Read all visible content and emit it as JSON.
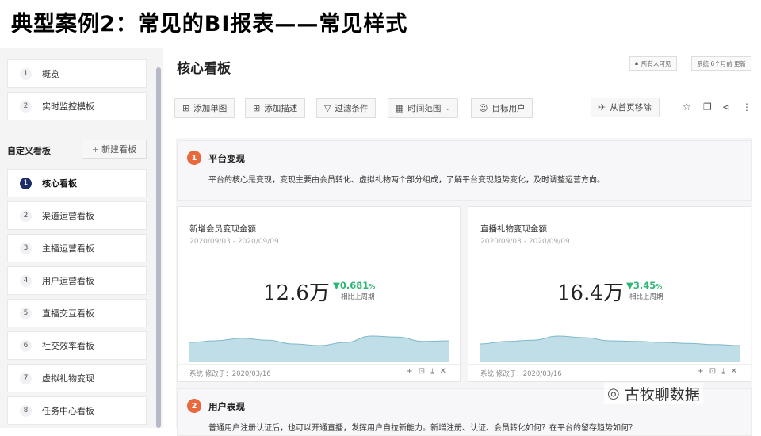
{
  "slide_title": "典型案例2：常见的BI报表——常见样式",
  "sidebar": {
    "top_items": [
      {
        "num": "1",
        "label": "概览"
      },
      {
        "num": "2",
        "label": "实时监控模板"
      }
    ],
    "section_label": "自定义看板",
    "new_board_label": "新建看板",
    "boards": [
      {
        "num": "1",
        "label": "核心看板",
        "active": true
      },
      {
        "num": "2",
        "label": "渠道运营看板"
      },
      {
        "num": "3",
        "label": "主播运营看板"
      },
      {
        "num": "4",
        "label": "用户运营看板"
      },
      {
        "num": "5",
        "label": "直播交互看板"
      },
      {
        "num": "6",
        "label": "社交效率看板"
      },
      {
        "num": "7",
        "label": "虚拟礼物变现"
      },
      {
        "num": "8",
        "label": "任务中心看板"
      }
    ]
  },
  "header": {
    "title": "核心看板",
    "visibility": "所有人可见",
    "updated": "系统 6个月前 更新"
  },
  "toolbar": {
    "add_chart": "添加单图",
    "add_desc": "添加描述",
    "filter": "过滤条件",
    "time_range": "时间范围",
    "target_users": "目标用户",
    "remove_home": "从首页移除"
  },
  "sections": [
    {
      "num": "1",
      "title": "平台变现",
      "desc": "平台的核心是变现，变现主要由会员转化、虚拟礼物两个部分组成，了解平台变现趋势变化，及时调整运营方向。"
    },
    {
      "num": "2",
      "title": "用户表现",
      "desc": "普通用户注册认证后，也可以开通直播，发挥用户自拉新能力。新增注册、认证、会员转化如何？在平台的留存趋势如何？"
    }
  ],
  "cards": [
    {
      "title": "新增会员变现金额",
      "date": "2020/09/03 - 2020/09/09",
      "value": "12.6万",
      "change": "0.681",
      "change_unit": "%",
      "change_label": "相比上周期",
      "footer": "系统  修改于：2020/03/16",
      "trend": [
        0.55,
        0.6,
        0.68,
        0.62,
        0.5,
        0.45,
        0.55,
        0.75,
        0.72,
        0.58,
        0.6
      ]
    },
    {
      "title": "直播礼物变现金额",
      "date": "2020/09/03 - 2020/09/09",
      "value": "16.4万",
      "change": "3.45",
      "change_unit": "%",
      "change_label": "相比上周期",
      "footer": "系统  修改于：2020/03/16",
      "trend": [
        0.5,
        0.58,
        0.62,
        0.75,
        0.7,
        0.6,
        0.58,
        0.55,
        0.52,
        0.48,
        0.45
      ]
    }
  ],
  "watermark": "古牧聊数据",
  "colors": {
    "accent_navy": "#1e2c66",
    "section_orange": "#e8693e",
    "positive_green": "#2bb673",
    "spark_fill": "#a9d3df"
  }
}
